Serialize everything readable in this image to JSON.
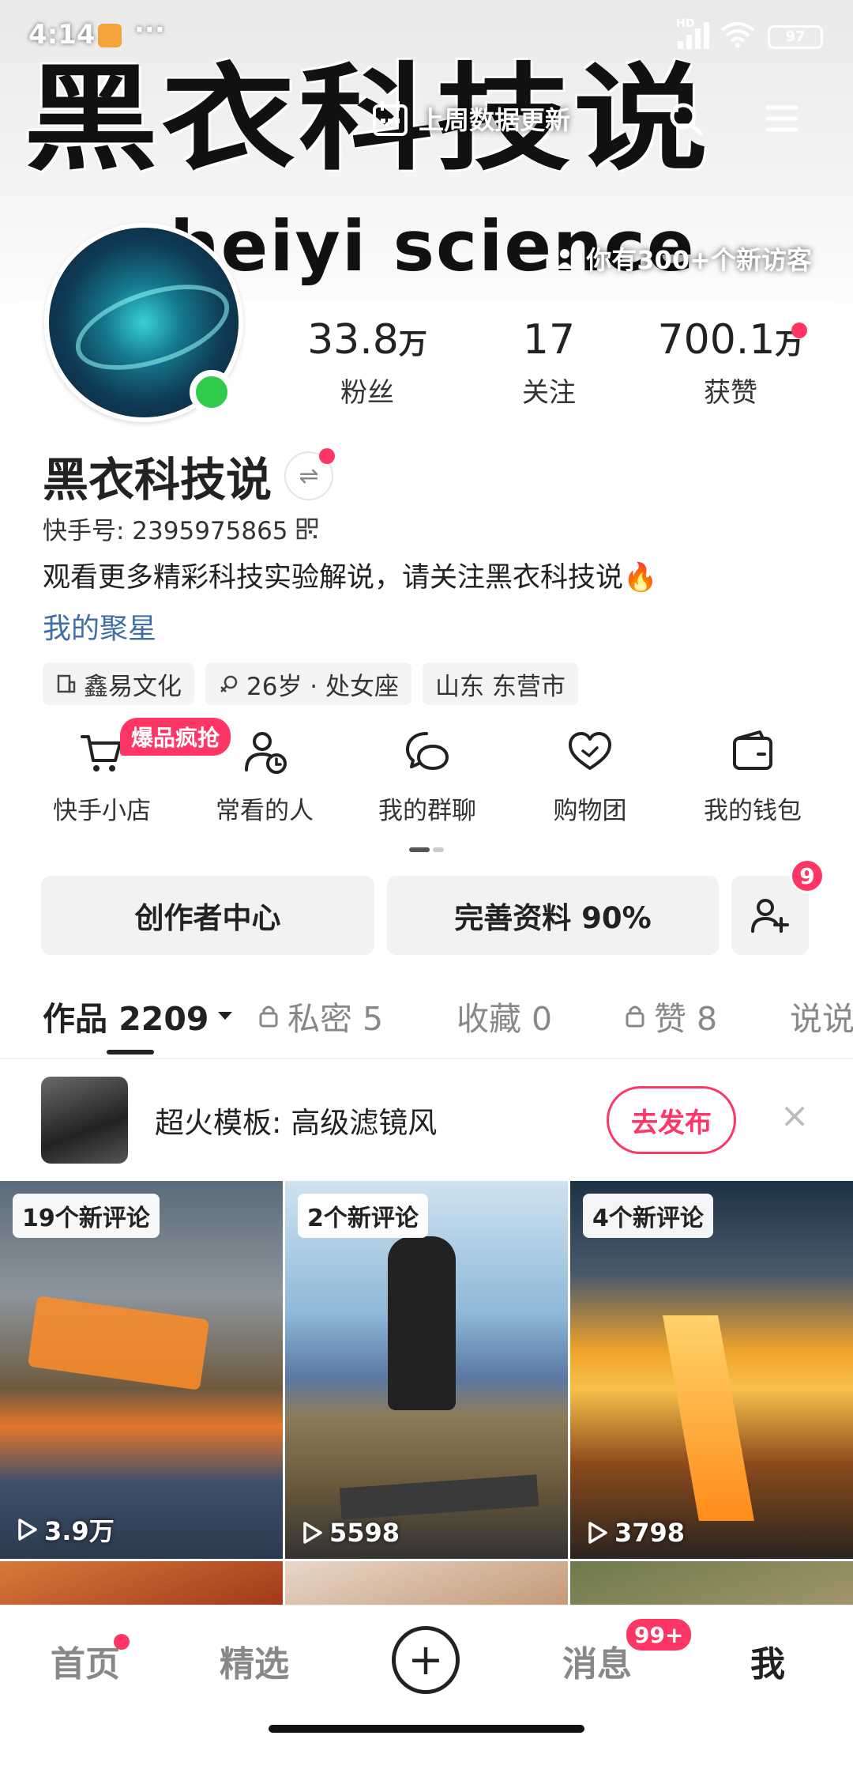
{
  "status_bar": {
    "time": "4:14",
    "more": "···",
    "network": "HD",
    "battery": "97"
  },
  "banner": {
    "title": "黑衣科技说",
    "subtitle": "heiyi science",
    "update_label": "上周数据更新",
    "visitors_text": "你有300+个新访客"
  },
  "stats": [
    {
      "num": "33.8",
      "unit": "万",
      "label": "粉丝"
    },
    {
      "num": "17",
      "unit": "",
      "label": "关注"
    },
    {
      "num": "700.1",
      "unit": "万",
      "label": "获赞"
    }
  ],
  "profile": {
    "name": "黑衣科技说",
    "switch_icon": "⇌",
    "kuaishou_id": "快手号: 2395975865",
    "bio": "观看更多精彩科技实验解说，请关注黑衣科技说",
    "bio_emoji": "🔥",
    "juxing": "我的聚星"
  },
  "tags": [
    {
      "icon": "building-icon",
      "label": "鑫易文化"
    },
    {
      "icon": "gender-icon",
      "label": "26岁 · 处女座"
    },
    {
      "icon": "",
      "label": "山东 东营市"
    }
  ],
  "shortcuts": [
    {
      "icon": "cart-icon",
      "label": "快手小店"
    },
    {
      "icon": "person-clock-icon",
      "label": "常看的人"
    },
    {
      "icon": "chat-icon",
      "label": "我的群聊"
    },
    {
      "icon": "heart-icon",
      "label": "购物团"
    },
    {
      "icon": "wallet-icon",
      "label": "我的钱包"
    }
  ],
  "hot_badge": "爆品疯抢",
  "buttons": {
    "creator": "创作者中心",
    "profile": "完善资料 90%",
    "add_friend_badge": "9"
  },
  "tabs": [
    {
      "label": "作品 2209",
      "active": true
    },
    {
      "label": "私密 5",
      "lock": true
    },
    {
      "label": "收藏 0"
    },
    {
      "label": "赞 8",
      "lock": true
    },
    {
      "label": "说说"
    }
  ],
  "template": {
    "text": "超火模板: 高级滤镜风",
    "button": "去发布",
    "close": "×"
  },
  "videos": [
    {
      "badge": "19个新评论",
      "plays": "3.9万"
    },
    {
      "badge": "2个新评论",
      "plays": "5598"
    },
    {
      "badge": "4个新评论",
      "plays": "3798"
    }
  ],
  "bottom_nav": {
    "home": "首页",
    "featured": "精选",
    "plus": "+",
    "messages": "消息",
    "messages_badge": "99+",
    "me": "我"
  },
  "colors": {
    "accent": "#fe3666",
    "link": "#3e6ea8",
    "online": "#2ecc4a"
  }
}
